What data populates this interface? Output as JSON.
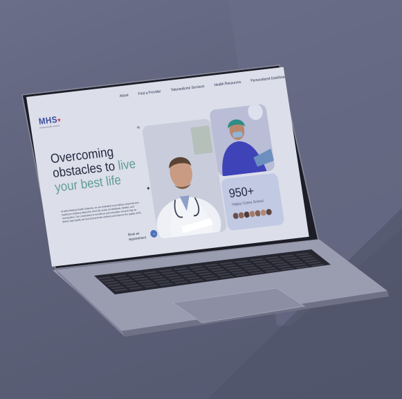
{
  "nav": {
    "items": [
      "About",
      "Find a Provider",
      "Telemedicine Services",
      "Health Resources",
      "Personalized Dashboard"
    ]
  },
  "brand": {
    "logo": "MHS",
    "tagline": "Medical Health Solutions"
  },
  "hero": {
    "title_line1": "Overcoming",
    "title_line2_a": "obstacles to ",
    "title_line2_b": "live",
    "title_line3": "your best life",
    "body": "At MHS Medical Health Solutions, we are dedicated to providing comprehensive healthcare solutions tailored to meet the needs of individuals, families, and communities. Our commitment to excellence and innovation ensures that we deliver high-quality services that promote wellness and improve the quality of life."
  },
  "cta": {
    "label_line1": "Book an",
    "label_line2": "Appointment",
    "arrow": "→"
  },
  "stats": {
    "value": "950+",
    "label": "Happy Cases Solved"
  },
  "colors": {
    "accent": "#5e9c97",
    "brand": "#3d4e9c",
    "button": "#4b71b8"
  }
}
